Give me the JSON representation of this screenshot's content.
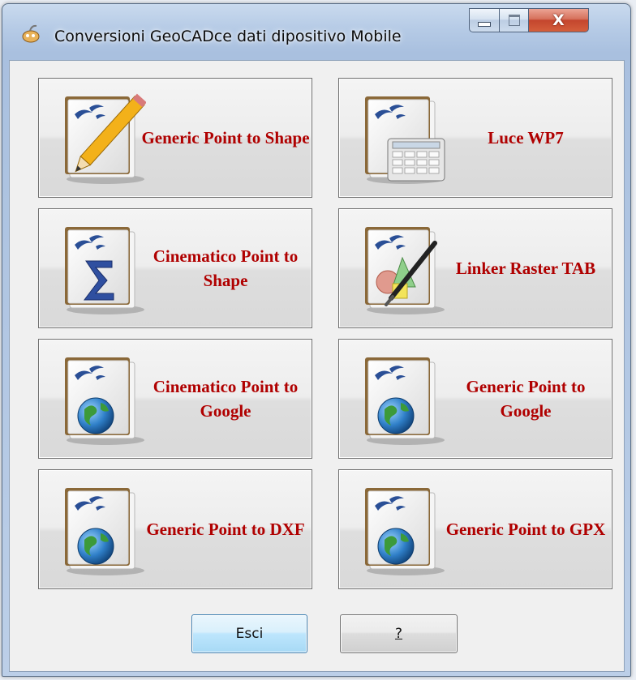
{
  "window": {
    "title": "Conversioni GeoCADce dati dipositivo Mobile",
    "minimize_label": "",
    "maximize_label": "",
    "close_label": "X"
  },
  "tiles": [
    {
      "label": "Generic Point to Shape",
      "icon": "pencil-document-icon"
    },
    {
      "label": "Luce WP7",
      "icon": "calculator-document-icon"
    },
    {
      "label": "Cinematico Point to Shape",
      "icon": "sigma-document-icon"
    },
    {
      "label": "Linker Raster TAB",
      "icon": "drawing-document-icon"
    },
    {
      "label": "Cinematico Point to Google",
      "icon": "globe-document-icon"
    },
    {
      "label": "Generic Point to Google",
      "icon": "globe-document-icon"
    },
    {
      "label": "Generic Point to DXF",
      "icon": "globe-document-icon"
    },
    {
      "label": "Generic Point to GPX",
      "icon": "globe-document-icon"
    }
  ],
  "buttons": {
    "exit_label": "Esci",
    "help_label": "?"
  },
  "colors": {
    "tile_label": "#b00000",
    "default_button_border": "#3c7fb1",
    "close_button": "#c4452d"
  }
}
